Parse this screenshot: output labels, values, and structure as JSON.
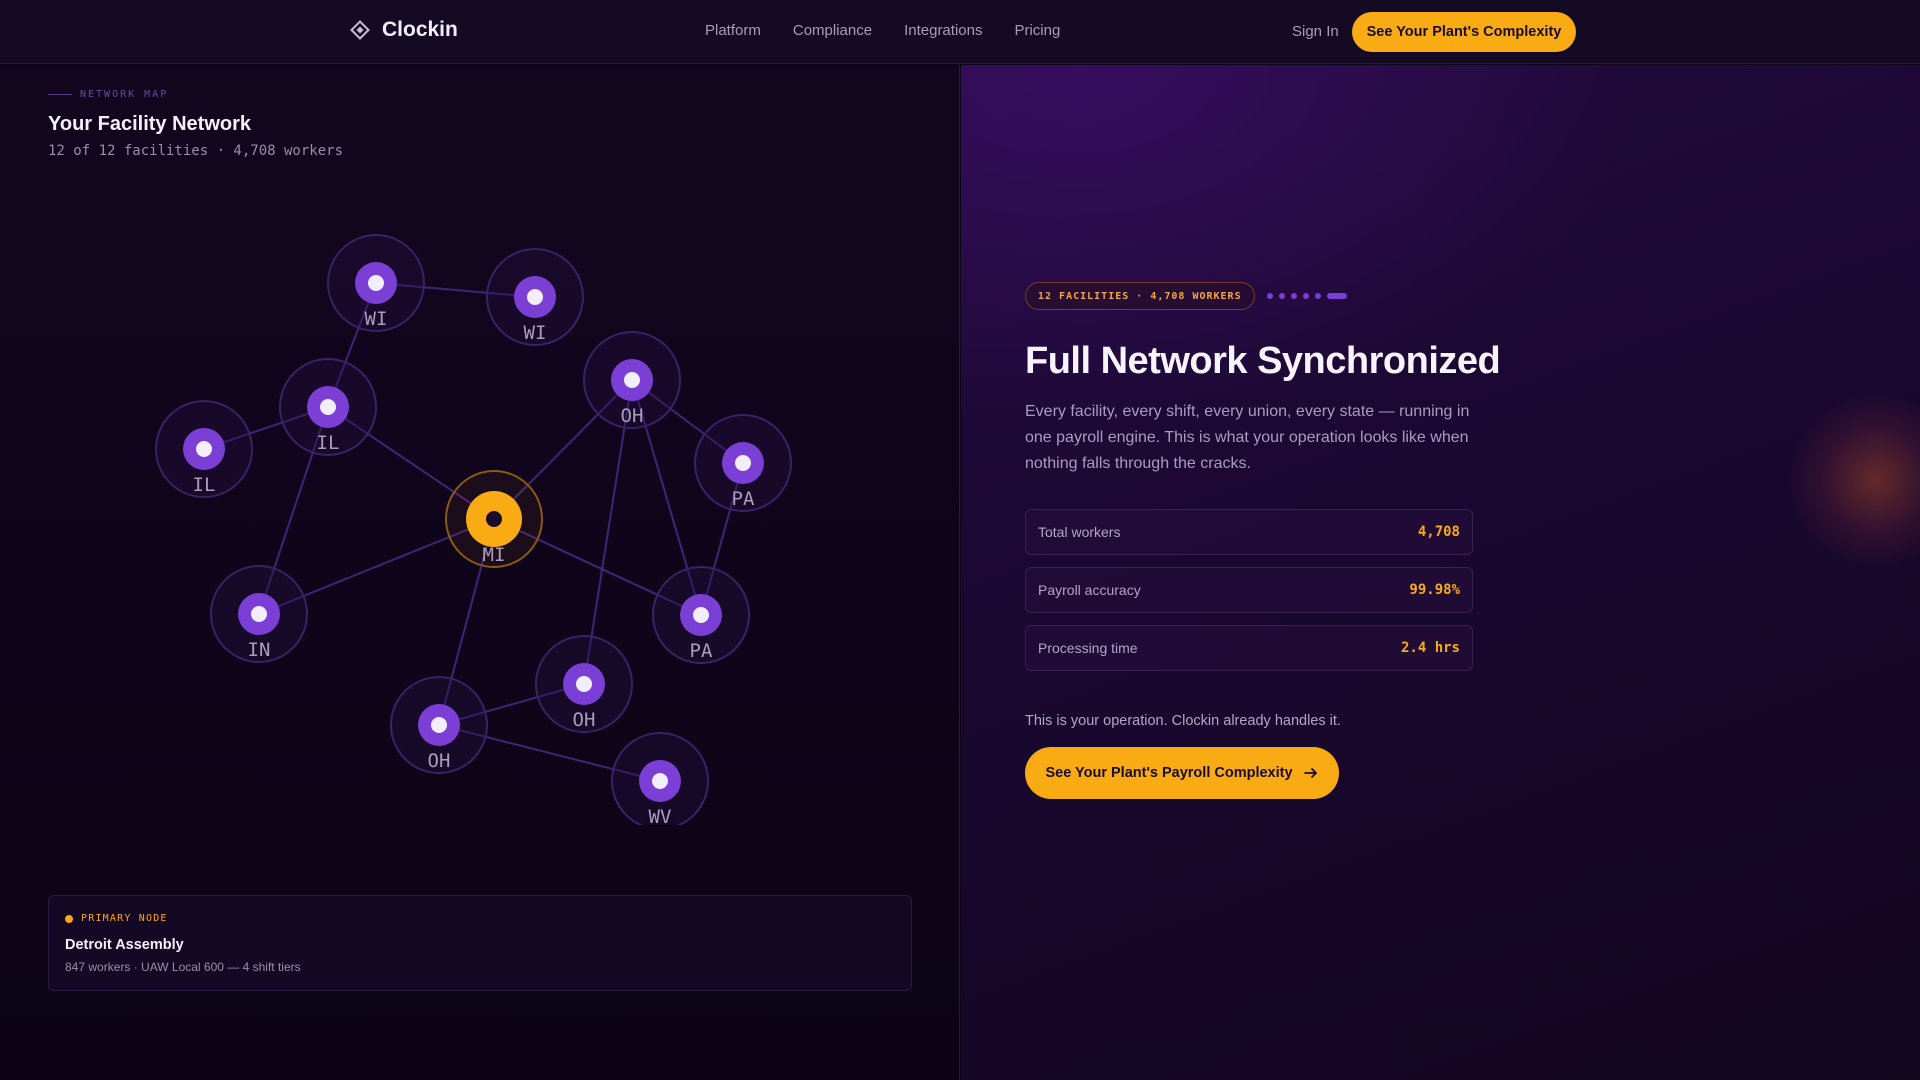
{
  "header": {
    "brand": "Clockin",
    "nav": [
      "Platform",
      "Compliance",
      "Integrations",
      "Pricing"
    ],
    "sign_in": "Sign In",
    "cta": "See Your Plant's Complexity"
  },
  "network": {
    "eyebrow": "NETWORK MAP",
    "title": "Your Facility Network",
    "subtitle": "12 of 12 facilities · 4,708 workers",
    "nodes": [
      {
        "label": "WI",
        "primary": false
      },
      {
        "label": "WI",
        "primary": false
      },
      {
        "label": "IL",
        "primary": false
      },
      {
        "label": "IL",
        "primary": false
      },
      {
        "label": "OH",
        "primary": false
      },
      {
        "label": "PA",
        "primary": false
      },
      {
        "label": "MI",
        "primary": true
      },
      {
        "label": "IN",
        "primary": false
      },
      {
        "label": "PA",
        "primary": false
      },
      {
        "label": "OH",
        "primary": false
      },
      {
        "label": "OH",
        "primary": false
      },
      {
        "label": "WV",
        "primary": false
      }
    ],
    "edges": [
      [
        0,
        1
      ],
      [
        0,
        3
      ],
      [
        2,
        3
      ],
      [
        3,
        6
      ],
      [
        3,
        7
      ],
      [
        6,
        4
      ],
      [
        6,
        7
      ],
      [
        6,
        8
      ],
      [
        6,
        9
      ],
      [
        4,
        5
      ],
      [
        4,
        8
      ],
      [
        4,
        10
      ],
      [
        5,
        8
      ],
      [
        9,
        10
      ],
      [
        9,
        11
      ]
    ],
    "primary_card": {
      "label": "PRIMARY NODE",
      "name": "Detroit Assembly",
      "detail": "847 workers · UAW Local 600 — 4 shift tiers"
    }
  },
  "summary": {
    "badge": "12 FACILITIES · 4,708 WORKERS",
    "headline": "Full Network Synchronized",
    "description": "Every facility, every shift, every union, every state — running in one payroll engine. This is what your operation looks like when nothing falls through the cracks.",
    "stats": [
      {
        "label": "Total workers",
        "value": "4,708"
      },
      {
        "label": "Payroll accuracy",
        "value": "99.98%"
      },
      {
        "label": "Processing time",
        "value": "2.4 hrs"
      }
    ],
    "note": "This is your operation. Clockin already handles it.",
    "cta": "See Your Plant's Payroll Complexity"
  },
  "colors": {
    "accent": "#f8ab12",
    "node": "#7b3fd6",
    "background": "#0d0518"
  },
  "icons": {
    "brand": "diamond-logo-icon",
    "cta_arrow": "arrow-right-icon"
  }
}
